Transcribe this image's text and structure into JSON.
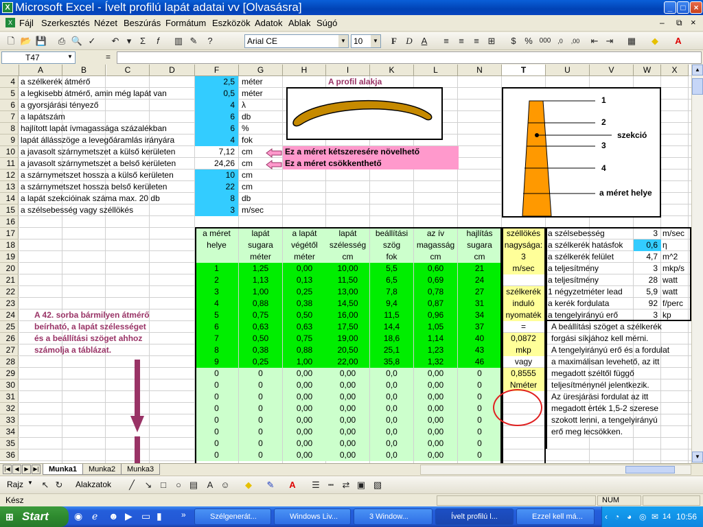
{
  "window": {
    "title": "Microsoft Excel - Ívelt profilú lapát adatai vv  [Olvasásra]"
  },
  "menu": [
    "Fájl",
    "Szerkesztés",
    "Nézet",
    "Beszúrás",
    "Formátum",
    "Eszközök",
    "Adatok",
    "Ablak",
    "Súgó"
  ],
  "toolbar": {
    "font": "Arial CE",
    "size": "10"
  },
  "formula": {
    "cell_ref": "T47",
    "fx": "=",
    "value": ""
  },
  "columns": [
    "A",
    "B",
    "C",
    "D",
    "F",
    "G",
    "H",
    "I",
    "K",
    "L",
    "N",
    "T",
    "U",
    "V",
    "W",
    "X"
  ],
  "rows": [
    "4",
    "5",
    "6",
    "7",
    "8",
    "9",
    "10",
    "11",
    "12",
    "13",
    "14",
    "15",
    "16",
    "17",
    "18",
    "19",
    "20",
    "21",
    "22",
    "23",
    "24",
    "25",
    "26",
    "27",
    "28",
    "29",
    "30",
    "31",
    "32",
    "33",
    "34",
    "35",
    "36"
  ],
  "params": [
    {
      "label": "a szélkerék átmérő",
      "value": "2,5",
      "unit": "méter"
    },
    {
      "label": "a legkisebb átmérő, amin még lapát van",
      "value": "0,5",
      "unit": "méter"
    },
    {
      "label": "a gyorsjárási tényező",
      "value": "4",
      "unit": "λ"
    },
    {
      "label": "a lapátszám",
      "value": "6",
      "unit": "db"
    },
    {
      "label": "hajlított lapát ívmagassága százalékban",
      "value": "6",
      "unit": "%"
    },
    {
      "label": "lapát állásszöge a levegőáramlás irányára",
      "value": "4",
      "unit": "fok"
    },
    {
      "label": "a javasolt szárnymetszet a külső kerületen",
      "value": "7,12",
      "unit": "cm"
    },
    {
      "label": "a javasolt szárnymetszet a belső kerületen",
      "value": "24,26",
      "unit": "cm"
    },
    {
      "label": "a szárnymetszet hossza a külső kerületen",
      "value": "10",
      "unit": "cm"
    },
    {
      "label": "a szárnymetszet hossza belső kerületen",
      "value": "22",
      "unit": "cm"
    },
    {
      "label": "a lapát szekcióinak száma max. 20 db",
      "value": "8",
      "unit": "db"
    },
    {
      "label": "a szélsebesség vagy széllökés",
      "value": "3",
      "unit": "m/sec"
    }
  ],
  "notes": {
    "note1": "Ez a méret kétszeresére növelhető",
    "note2": "Ez a méret csökkenthető"
  },
  "profile_title": "A profil alakja",
  "blade_labels": [
    "1",
    "2",
    "szekció",
    "3",
    "4",
    "a méret helye"
  ],
  "table": {
    "headers": [
      [
        "a méret",
        "helye",
        ""
      ],
      [
        "lapát",
        "sugara",
        "méter"
      ],
      [
        "a lapát",
        "végétől",
        "méter"
      ],
      [
        "lapát",
        "szélesség",
        "cm"
      ],
      [
        "beállítási",
        "szög",
        "fok"
      ],
      [
        "az ív",
        "magasság",
        "cm"
      ],
      [
        "hajlítás",
        "sugara",
        "cm"
      ]
    ],
    "rows": [
      [
        "1",
        "1,25",
        "0,00",
        "10,00",
        "5,5",
        "0,60",
        "21"
      ],
      [
        "2",
        "1,13",
        "0,13",
        "11,50",
        "6,5",
        "0,69",
        "24"
      ],
      [
        "3",
        "1,00",
        "0,25",
        "13,00",
        "7,8",
        "0,78",
        "27"
      ],
      [
        "4",
        "0,88",
        "0,38",
        "14,50",
        "9,4",
        "0,87",
        "31"
      ],
      [
        "5",
        "0,75",
        "0,50",
        "16,00",
        "11,5",
        "0,96",
        "34"
      ],
      [
        "6",
        "0,63",
        "0,63",
        "17,50",
        "14,4",
        "1,05",
        "37"
      ],
      [
        "7",
        "0,50",
        "0,75",
        "19,00",
        "18,6",
        "1,14",
        "40"
      ],
      [
        "8",
        "0,38",
        "0,88",
        "20,50",
        "25,1",
        "1,23",
        "43"
      ],
      [
        "9",
        "0,25",
        "1,00",
        "22,00",
        "35,8",
        "1,32",
        "46"
      ],
      [
        "0",
        "0",
        "0,00",
        "0,00",
        "0,0",
        "0,00",
        "0"
      ],
      [
        "0",
        "0",
        "0,00",
        "0,00",
        "0,0",
        "0,00",
        "0"
      ],
      [
        "0",
        "0",
        "0,00",
        "0,00",
        "0,0",
        "0,00",
        "0"
      ],
      [
        "0",
        "0",
        "0,00",
        "0,00",
        "0,0",
        "0,00",
        "0"
      ],
      [
        "0",
        "0",
        "0,00",
        "0,00",
        "0,0",
        "0,00",
        "0"
      ],
      [
        "0",
        "0",
        "0,00",
        "0,00",
        "0,0",
        "0,00",
        "0"
      ],
      [
        "0",
        "0",
        "0,00",
        "0,00",
        "0,0",
        "0,00",
        "0"
      ],
      [
        "0",
        "0",
        "0,00",
        "0,00",
        "0,0",
        "0,00",
        "0"
      ]
    ]
  },
  "tcol": [
    "széllökés",
    "nagysága:",
    "3",
    "m/sec",
    "",
    "szélkerék",
    "induló",
    "nyomaték",
    "=",
    "0,0872",
    "mkp",
    "vagy",
    "0,8555",
    "Nméter"
  ],
  "right_results": [
    {
      "label": "a szélsebesség",
      "value": "3",
      "unit": "m/sec"
    },
    {
      "label": "a szélkerék hatásfok",
      "value": "0,6",
      "unit": "η"
    },
    {
      "label": "a szélkerék felület",
      "value": "4,7",
      "unit": "m^2"
    },
    {
      "label": "a teljesítmény",
      "value": "3",
      "unit": "mkp/s"
    },
    {
      "label": "a teljesítmény",
      "value": "28",
      "unit": "watt"
    },
    {
      "label": "1 négyzetméter lead",
      "value": "5,9",
      "unit": "watt"
    },
    {
      "label": "a kerék fordulata",
      "value": "92",
      "unit": "f/perc"
    },
    {
      "label": "a tengelyirányú erő",
      "value": "3",
      "unit": "kp"
    }
  ],
  "right_text": [
    "A beállítási szöget a szélkerék",
    "forgási síkjához kell mérni.",
    "A tengelyirányú erő és a fordulat",
    "a maximálisan levehető, az itt",
    "megadott széltől függő",
    "teljesítménynél jelentkezik.",
    "Az üresjárási fordulat az itt",
    "megadott érték 1,5-2 szerese",
    "szokott lenni, a tengelyirányú",
    "erő meg lecsökken."
  ],
  "left_note": [
    "A 42. sorba bármilyen átmérő",
    "beírható, a lapát szélességet",
    "és a beállítási szöget ahhoz",
    "számolja a táblázat."
  ],
  "sheets": [
    "Munka1",
    "Munka2",
    "Munka3"
  ],
  "drawbar": {
    "draw": "Rajz",
    "shapes": "Alakzatok"
  },
  "status": {
    "ready": "Kész",
    "num": "NUM"
  },
  "taskbar": {
    "start": "Start",
    "tasks": [
      "Szélgenerát...",
      "Windows Liv...",
      "3 Window...",
      "Ívelt profilú l...",
      "Ezzel kell má..."
    ],
    "clock": "10:56",
    "tray_num": "14"
  },
  "colors": {
    "input": "#33ccff",
    "note": "#ff99cc",
    "green": "#00ee00",
    "lightgreen": "#ccffcc",
    "yellow": "#ffff99",
    "maroon": "#993366",
    "blade": "#ff9900",
    "profile": "#c68a00"
  }
}
